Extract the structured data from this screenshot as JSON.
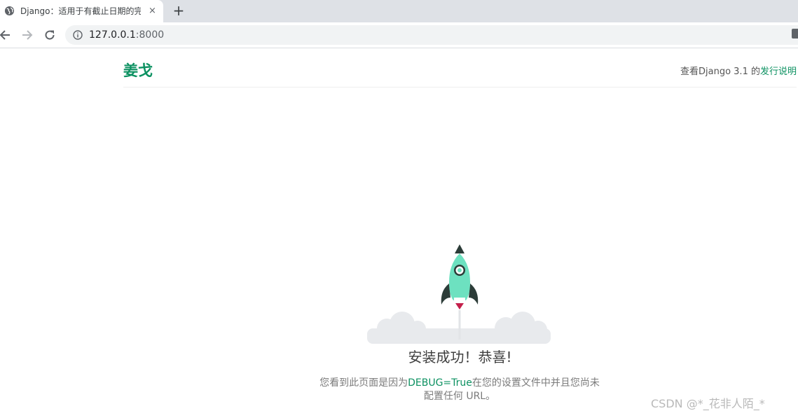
{
  "browser": {
    "tab": {
      "title": "Django：适用于有截止日期的完",
      "close_label": "×"
    },
    "new_tab_label": "+",
    "url": {
      "host": "127.0.0.1",
      "port": ":8000"
    }
  },
  "page": {
    "brand": "姜戈",
    "release": {
      "prefix": "查看Django 3.1 的",
      "link": "发行说明"
    },
    "headline": "安装成功！恭喜!",
    "description": {
      "before": "您看到此页面是因为",
      "code": "DEBUG=True",
      "after": "在您的设置文件中并且您尚未配置任何 URL。"
    }
  },
  "watermark": "CSDN @*_花非人陌_*",
  "colors": {
    "accent": "#0c9161",
    "rocket_body": "#6de1c0",
    "rocket_dark": "#2c3c38",
    "flame": "#c4204b",
    "cloud": "#e8eaed"
  }
}
